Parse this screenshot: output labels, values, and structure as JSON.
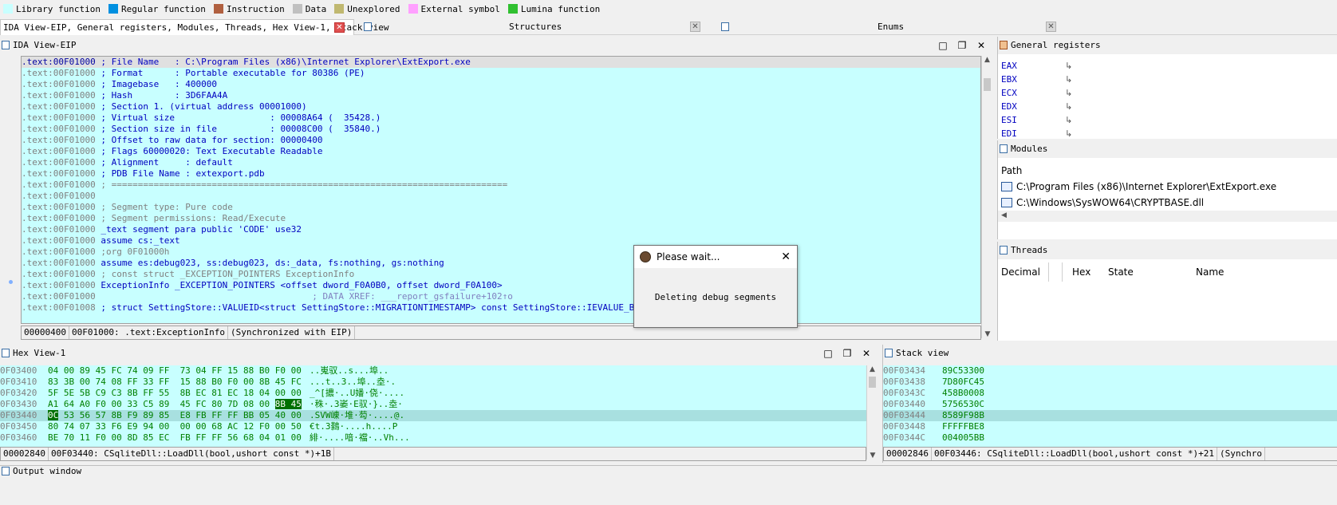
{
  "legend": [
    {
      "label": "Library function",
      "color": "#c8ffff"
    },
    {
      "label": "Regular function",
      "color": "#0090e0"
    },
    {
      "label": "Instruction",
      "color": "#b06040"
    },
    {
      "label": "Data",
      "color": "#c0c0c0"
    },
    {
      "label": "Unexplored",
      "color": "#c0b870"
    },
    {
      "label": "External symbol",
      "color": "#ffa0ff"
    },
    {
      "label": "Lumina function",
      "color": "#30c030"
    }
  ],
  "tabs": {
    "main": "IDA View-EIP, General registers, Modules, Threads, Hex View-1, Stack view",
    "structures": "Structures",
    "enums": "Enums"
  },
  "ida_view": {
    "title": "IDA View-EIP",
    "lines": [
      {
        "addr": ".text:00F01000",
        "text": " ; File Name   : C:\\Program Files (x86)\\Internet Explorer\\ExtExport.exe",
        "style": "cmt",
        "selected": true
      },
      {
        "addr": ".text:00F01000",
        "text": " ; Format      : Portable executable for 80386 (PE)",
        "style": "cmt"
      },
      {
        "addr": ".text:00F01000",
        "text": " ; Imagebase   : 400000",
        "style": "cmt"
      },
      {
        "addr": ".text:00F01000",
        "text": " ; Hash        : 3D6FAA4A",
        "style": "cmt"
      },
      {
        "addr": ".text:00F01000",
        "text": " ; Section 1. (virtual address 00001000)",
        "style": "cmt"
      },
      {
        "addr": ".text:00F01000",
        "text": " ; Virtual size                  : 00008A64 (  35428.)",
        "style": "cmt"
      },
      {
        "addr": ".text:00F01000",
        "text": " ; Section size in file          : 00008C00 (  35840.)",
        "style": "cmt"
      },
      {
        "addr": ".text:00F01000",
        "text": " ; Offset to raw data for section: 00000400",
        "style": "cmt"
      },
      {
        "addr": ".text:00F01000",
        "text": " ; Flags 60000020: Text Executable Readable",
        "style": "cmt"
      },
      {
        "addr": ".text:00F01000",
        "text": " ; Alignment     : default",
        "style": "cmt"
      },
      {
        "addr": ".text:00F01000",
        "text": " ; PDB File Name : extexport.pdb",
        "style": "cmt"
      },
      {
        "addr": ".text:00F01000",
        "text": " ; ===========================================================================",
        "style": "cmt-gray"
      },
      {
        "addr": ".text:00F01000",
        "text": "",
        "style": "cmt"
      },
      {
        "addr": ".text:00F01000",
        "text": " ; Segment type: Pure code",
        "style": "cmt-gray"
      },
      {
        "addr": ".text:00F01000",
        "text": " ; Segment permissions: Read/Execute",
        "style": "cmt-gray"
      },
      {
        "addr": ".text:00F01000",
        "text": " _text segment para public 'CODE' use32",
        "style": "kw"
      },
      {
        "addr": ".text:00F01000",
        "text": " assume cs:_text",
        "style": "kw"
      },
      {
        "addr": ".text:00F01000",
        "text": " ;org 0F01000h",
        "style": "cmt-gray"
      },
      {
        "addr": ".text:00F01000",
        "text": " assume es:debug023, ss:debug023, ds:_data, fs:nothing, gs:nothing",
        "style": "kw"
      },
      {
        "addr": ".text:00F01000",
        "text": " ; const struct _EXCEPTION_POINTERS ExceptionInfo",
        "style": "cmt-gray"
      },
      {
        "addr": ".text:00F01000",
        "text": " ExceptionInfo _EXCEPTION_POINTERS <offset dword_F0A0B0, offset dword_F0A100>",
        "style": "kw"
      },
      {
        "addr": ".text:00F01000",
        "text": "                                         ; DATA XREF: ___report_gsfailure+102↑o",
        "style": "xref"
      },
      {
        "addr": ".text:00F01008",
        "text": " ; struct SettingStore::VALUEID<struct SettingStore::MIGRATIONTIMESTAMP> const SettingStore::IEVALUE_Bro",
        "style": "cmt"
      }
    ],
    "status": [
      "00000400",
      "00F01000: .text:ExceptionInfo",
      "(Synchronized with EIP)"
    ]
  },
  "registers": {
    "title": "General registers",
    "items": [
      "EAX",
      "EBX",
      "ECX",
      "EDX",
      "ESI",
      "EDI"
    ]
  },
  "modules": {
    "title": "Modules",
    "column": "Path",
    "items": [
      "C:\\Program Files (x86)\\Internet Explorer\\ExtExport.exe",
      "C:\\Windows\\SysWOW64\\CRYPTBASE.dll"
    ]
  },
  "threads": {
    "title": "Threads",
    "columns": [
      "Decimal",
      "Hex",
      "State",
      "Name"
    ]
  },
  "hex_view": {
    "title": "Hex View-1",
    "rows": [
      {
        "addr": "0F03400",
        "bytes": "04 00 89 45 FC 74 09 FF  73 04 FF 15 88 B0 F0 00",
        "ascii": "..嵬驭..s...埠.."
      },
      {
        "addr": "0F03410",
        "bytes": "83 3B 00 74 08 FF 33 FF  15 88 B0 F0 00 8B 45 FC",
        "ascii": "...t..3..埠..坴·."
      },
      {
        "addr": "0F03420",
        "bytes": "5F 5E 5B C9 C3 8B FF 55  8B EC 81 EC 18 04 00 00",
        "ascii": "_^[擃·..U嬏·侥·...."
      },
      {
        "addr": "0F03430",
        "bytes": "A1 64 A0 F0 00 33 C5 89  45 FC 80 7D 08 00 8B 45",
        "ascii": "·秼·.3崣·E驭·}..坴·"
      },
      {
        "addr": "0F03440",
        "bytes": "0C 53 56 57 8B F9 89 85  E8 FB FF FF BB 05 40 00",
        "ascii": ".SVW崠·堆·芶·....@."
      },
      {
        "addr": "0F03450",
        "bytes": "80 74 07 33 F6 E9 94 00  00 00 68 AC 12 F0 00 50",
        "ascii": "€t.3鷋·....h....P"
      },
      {
        "addr": "0F03460",
        "bytes": "BE 70 11 F0 00 8D 85 EC  FB FF FF 56 68 04 01 00",
        "ascii": "緋·....喑·襠·..Vh..."
      }
    ],
    "status": [
      "00002840",
      "00F03440: CSqliteDll::LoadDll(bool,ushort const *)+1B"
    ]
  },
  "stack_view": {
    "title": "Stack view",
    "rows": [
      {
        "addr": "00F03434",
        "val": "89C53300"
      },
      {
        "addr": "00F03438",
        "val": "7D80FC45"
      },
      {
        "addr": "00F0343C",
        "val": "458B0008"
      },
      {
        "addr": "00F03440",
        "val": "5756530C"
      },
      {
        "addr": "00F03444",
        "val": "8589F98B"
      },
      {
        "addr": "00F03448",
        "val": "FFFFFBE8"
      },
      {
        "addr": "00F0344C",
        "val": "004005BB"
      }
    ],
    "status": [
      "00002846",
      "00F03446: CSqliteDll::LoadDll(bool,ushort const *)+21",
      "(Synchro"
    ]
  },
  "dialog": {
    "title": "Please wait...",
    "message": "Deleting debug segments"
  },
  "output": {
    "title": "Output window"
  }
}
